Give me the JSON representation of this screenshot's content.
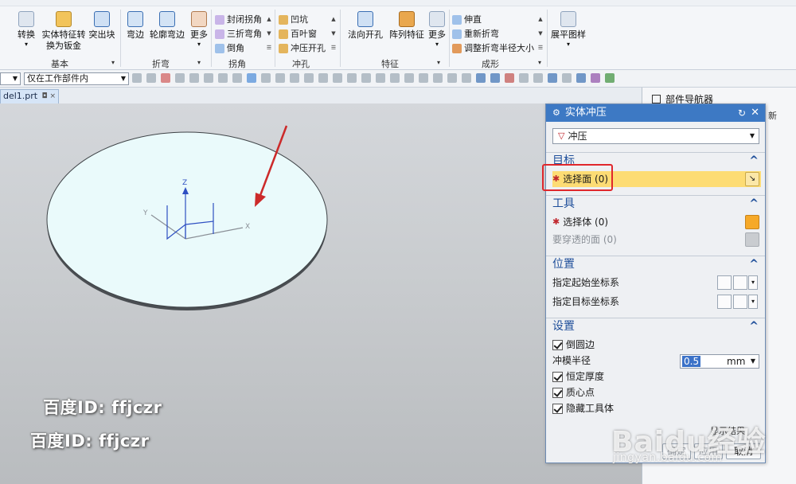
{
  "ribbon": {
    "buttons": {
      "convert": "转换",
      "solid_to_sheet_line1": "实体特征转",
      "solid_to_sheet_line2": "换为钣金",
      "extruded_tab": "突出块",
      "flange": "弯边",
      "contour_flange": "轮廓弯边",
      "more_bend": "更多",
      "normal_cutout": "法向开孔",
      "pattern_feature": "阵列特征",
      "more_feature": "更多",
      "flat_pattern": "展平图样"
    },
    "corner_list": [
      "封闭拐角",
      "三折弯角",
      "倒角"
    ],
    "punch_list": [
      "凹坑",
      "百叶窗",
      "冲压开孔"
    ],
    "form_list": [
      "伸直",
      "重新折弯",
      "调整折弯半径大小"
    ],
    "groups": {
      "basic": "基本",
      "bend": "折弯",
      "corner": "拐角",
      "punch": "冲孔",
      "feature": "特征",
      "form": "成形"
    }
  },
  "toolbar2": {
    "selection_scope": "仅在工作部件内"
  },
  "doc_tab": {
    "label": "del1.prt"
  },
  "navigator": {
    "title": "部件导航器",
    "partial_text": "新"
  },
  "viewport": {
    "axis_labels": {
      "z": "Z",
      "y": "Y",
      "x": "X"
    },
    "watermarks": [
      "百度ID: ffjczr",
      "百度ID: ffjczr"
    ]
  },
  "dialog": {
    "title": "实体冲压",
    "type_value": "冲压",
    "sections": {
      "target": {
        "title": "目标",
        "select_face": "选择面 (0)"
      },
      "tool": {
        "title": "工具",
        "select_body": "选择体 (0)",
        "pierce_face": "要穿透的面 (0)"
      },
      "position": {
        "title": "位置",
        "from_csys": "指定起始坐标系",
        "to_csys": "指定目标坐标系"
      },
      "settings": {
        "title": "设置",
        "round_edges": "倒圆边",
        "die_radius_label": "冲模半径",
        "die_radius_value": "0.5",
        "die_radius_unit": "mm",
        "constant_thickness": "恒定厚度",
        "centroid": "质心点",
        "hide_tool": "隐藏工具体"
      }
    },
    "buttons": {
      "ok": "确定",
      "apply": "应用",
      "cancel": "取消"
    },
    "behind_text": "显示结果"
  },
  "brand_watermark": {
    "main": "Baidu经验",
    "sub": "jingyan.baidu.com"
  },
  "colors": {
    "title_bar": "#3d79c4",
    "highlight": "#fddc74",
    "annotation_red": "#e0272c",
    "disc_face": "#eafafb"
  }
}
